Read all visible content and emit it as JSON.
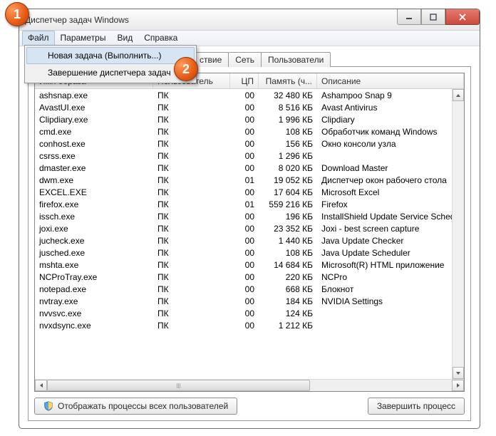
{
  "markers": {
    "one": "1",
    "two": "2"
  },
  "window": {
    "title": "Диспетчер задач Windows"
  },
  "menu": {
    "file": "Файл",
    "options": "Параметры",
    "view": "Вид",
    "help": "Справка"
  },
  "dropdown": {
    "newtask": "Новая задача (Выполнить...)",
    "exit": "Завершение диспетчера задач"
  },
  "tabs": {
    "services_partial": "ствие",
    "network": "Сеть",
    "users": "Пользователи"
  },
  "columns": {
    "name": "Имя образа",
    "user": "Пользователь",
    "cpu": "ЦП",
    "mem": "Память (ч...",
    "desc": "Описание"
  },
  "user_value": "ПК",
  "processes": [
    {
      "name": "ashsnap.exe",
      "cpu": "00",
      "mem": "32 480 КБ",
      "desc": "Ashampoo Snap 9"
    },
    {
      "name": "AvastUI.exe",
      "cpu": "00",
      "mem": "8 516 КБ",
      "desc": "Avast Antivirus"
    },
    {
      "name": "Clipdiary.exe",
      "cpu": "00",
      "mem": "1 996 КБ",
      "desc": "Clipdiary"
    },
    {
      "name": "cmd.exe",
      "cpu": "00",
      "mem": "108 КБ",
      "desc": "Обработчик команд Windows"
    },
    {
      "name": "conhost.exe",
      "cpu": "00",
      "mem": "156 КБ",
      "desc": "Окно консоли узла"
    },
    {
      "name": "csrss.exe",
      "cpu": "00",
      "mem": "1 296 КБ",
      "desc": ""
    },
    {
      "name": "dmaster.exe",
      "cpu": "00",
      "mem": "8 020 КБ",
      "desc": "Download Master"
    },
    {
      "name": "dwm.exe",
      "cpu": "01",
      "mem": "19 052 КБ",
      "desc": "Диспетчер окон рабочего стола"
    },
    {
      "name": "EXCEL.EXE",
      "cpu": "00",
      "mem": "17 604 КБ",
      "desc": "Microsoft Excel"
    },
    {
      "name": "firefox.exe",
      "cpu": "01",
      "mem": "559 216 КБ",
      "desc": "Firefox"
    },
    {
      "name": "issch.exe",
      "cpu": "00",
      "mem": "196 КБ",
      "desc": "InstallShield Update Service Scheduler"
    },
    {
      "name": "joxi.exe",
      "cpu": "00",
      "mem": "23 352 КБ",
      "desc": "Joxi - best screen capture"
    },
    {
      "name": "jucheck.exe",
      "cpu": "00",
      "mem": "1 440 КБ",
      "desc": "Java Update Checker"
    },
    {
      "name": "jusched.exe",
      "cpu": "00",
      "mem": "108 КБ",
      "desc": "Java Update Scheduler"
    },
    {
      "name": "mshta.exe",
      "cpu": "00",
      "mem": "14 684 КБ",
      "desc": "Microsoft(R) HTML приложение"
    },
    {
      "name": "NCProTray.exe",
      "cpu": "00",
      "mem": "220 КБ",
      "desc": "NCPro"
    },
    {
      "name": "notepad.exe",
      "cpu": "00",
      "mem": "668 КБ",
      "desc": "Блокнот"
    },
    {
      "name": "nvtray.exe",
      "cpu": "00",
      "mem": "184 КБ",
      "desc": "NVIDIA Settings"
    },
    {
      "name": "nvvsvc.exe",
      "cpu": "00",
      "mem": "124 КБ",
      "desc": ""
    },
    {
      "name": "nvxdsync.exe",
      "cpu": "00",
      "mem": "1 212 КБ",
      "desc": ""
    }
  ],
  "footer": {
    "show_all": "Отображать процессы всех пользователей",
    "end": "Завершить процесс"
  }
}
